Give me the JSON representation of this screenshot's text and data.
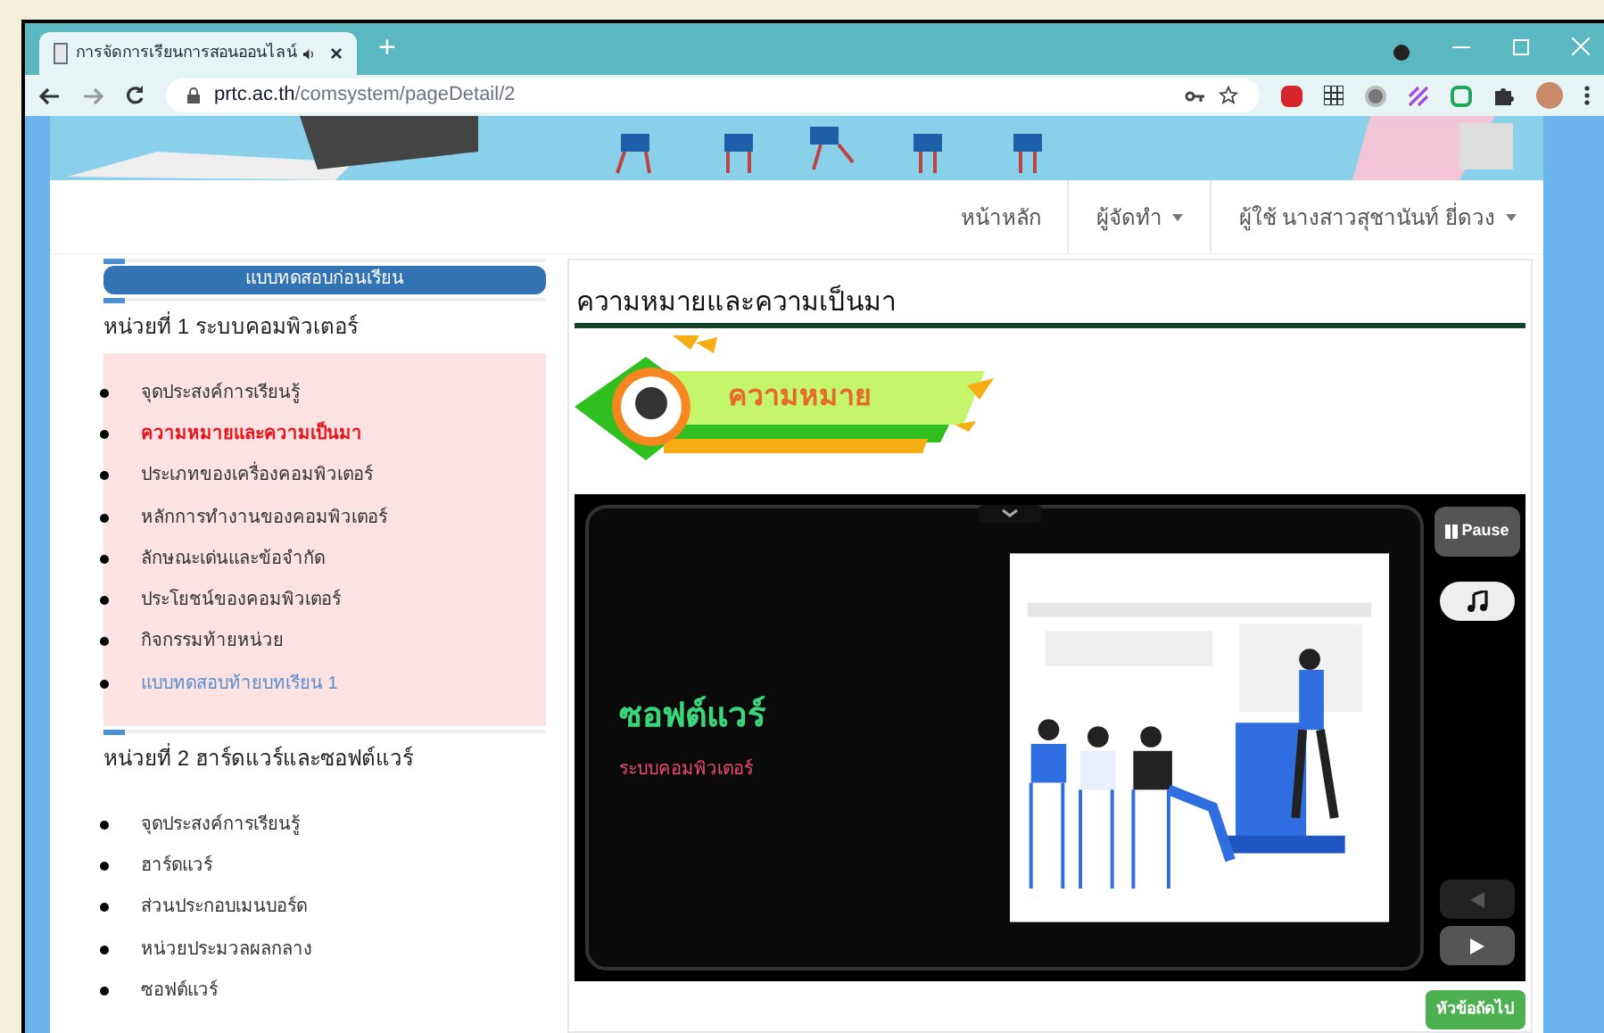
{
  "browser": {
    "tab_title": "การจัดการเรียนการสอนออนไลน์",
    "tab_close": "×",
    "new_tab": "+",
    "url_host": "prtc.ac.th",
    "url_path": "/comsystem/pageDetail/2"
  },
  "navbar": [
    {
      "label": "หน้าหลัก",
      "dropdown": false
    },
    {
      "label": "ผู้จัดทำ",
      "dropdown": true
    },
    {
      "label": "ผู้ใช้ นางสาวสุชานันท์ ยี่ดวง",
      "dropdown": true
    }
  ],
  "sidebar": {
    "pretest_button": "แบบทดสอบก่อนเรียน",
    "units": [
      {
        "title": "หน่วยที่ 1 ระบบคอมพิวเตอร์",
        "highlighted": true,
        "items": [
          {
            "label": "จุดประสงค์การเรียนรู้",
            "kind": "lesson",
            "selected": false
          },
          {
            "label": "ความหมายและความเป็นมา",
            "kind": "lesson",
            "selected": true
          },
          {
            "label": "ประเภทของเครื่องคอมพิวเตอร์",
            "kind": "lesson",
            "selected": false
          },
          {
            "label": "หลักการทำงานของคอมพิวเตอร์",
            "kind": "lesson",
            "selected": false
          },
          {
            "label": "ลักษณะเด่นและข้อจำกัด",
            "kind": "lesson",
            "selected": false
          },
          {
            "label": "ประโยชน์ของคอมพิวเตอร์",
            "kind": "lesson",
            "selected": false
          },
          {
            "label": "กิจกรรมท้ายหน่วย",
            "kind": "lesson",
            "selected": false
          },
          {
            "label": "แบบทดสอบท้ายบทเรียน 1",
            "kind": "quiz",
            "selected": false
          }
        ]
      },
      {
        "title": "หน่วยที่ 2 ฮาร์ดแวร์และซอฟต์แวร์",
        "highlighted": false,
        "items": [
          {
            "label": "จุดประสงค์การเรียนรู้",
            "kind": "lesson",
            "selected": false
          },
          {
            "label": "ฮาร์ดแวร์",
            "kind": "lesson",
            "selected": false
          },
          {
            "label": "ส่วนประกอบเมนบอร์ด",
            "kind": "lesson",
            "selected": false
          },
          {
            "label": "หน่วยประมวลผลกลาง",
            "kind": "lesson",
            "selected": false
          },
          {
            "label": "ซอฟต์แวร์",
            "kind": "lesson",
            "selected": false
          }
        ]
      }
    ]
  },
  "content": {
    "title": "ความหมายและความเป็นมา",
    "banner_label": "ความหมาย",
    "slide": {
      "heading": "ซอฟต์แวร์",
      "subheading": "ระบบคอมพิวเตอร์",
      "pause_button": "Pause"
    },
    "next_button": "หัวข้อถัดไป"
  }
}
